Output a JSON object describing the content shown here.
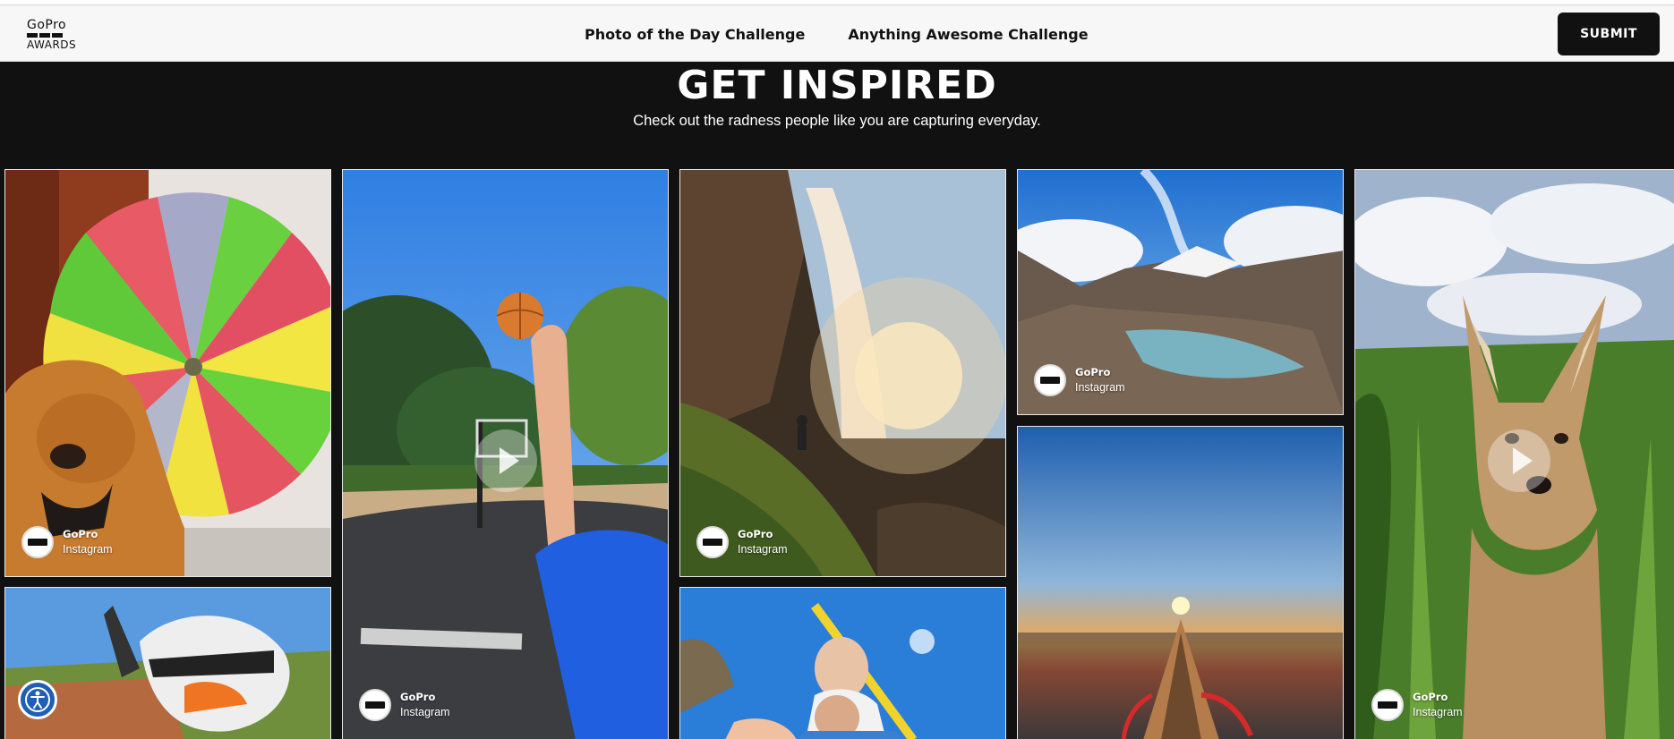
{
  "header": {
    "logo_top": "GoPro",
    "logo_bottom": "AWARDS",
    "nav": [
      "Photo of the Day Challenge",
      "Anything Awesome Challenge"
    ],
    "submit_label": "SUBMIT"
  },
  "hero": {
    "title": "GET INSPIRED",
    "subtitle": "Check out the radness people like you are capturing everyday."
  },
  "gallery": [
    {
      "subject": "golden retriever under a rainbow umbrella",
      "credit_name": "GoPro",
      "credit_source": "Instagram",
      "video": false
    },
    {
      "subject": "basketball shot from first person view",
      "credit_name": "GoPro",
      "credit_source": "Instagram",
      "video": true
    },
    {
      "subject": "hiker behind a waterfall",
      "credit_name": "GoPro",
      "credit_source": "Instagram",
      "video": false
    },
    {
      "subject": "mountain lake in the clouds",
      "credit_name": "GoPro",
      "credit_source": "Instagram",
      "video": false
    },
    {
      "subject": "coyote pup in tall grass",
      "credit_name": "GoPro",
      "credit_source": "Instagram",
      "video": true
    },
    {
      "subject": "motocross rider selfie",
      "video": false
    },
    {
      "subject": "family tubing on a boat",
      "video": false
    },
    {
      "subject": "kayak at sunset",
      "video": false
    }
  ],
  "colors": {
    "page_background": "#111111",
    "header_background": "#f7f7f7",
    "button_background": "#111111",
    "accessibility_button": "#1f5fb8"
  },
  "icons": [
    "play-icon",
    "accessibility-icon",
    "gopro-avatar-icon"
  ]
}
